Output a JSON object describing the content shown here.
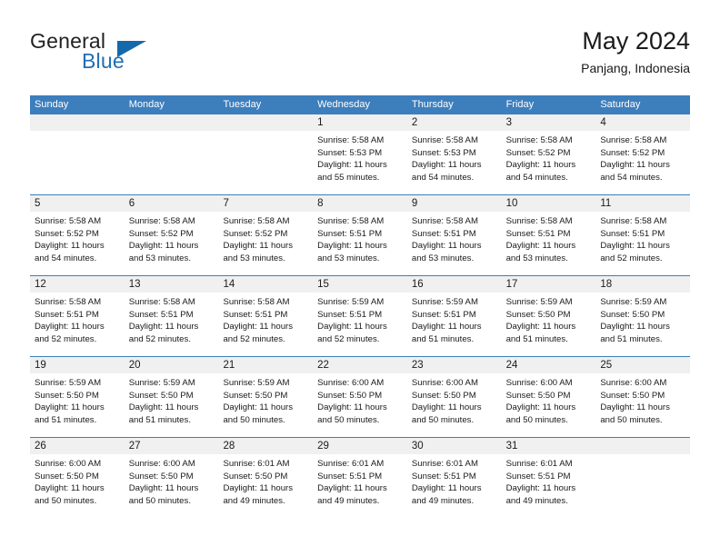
{
  "brand": {
    "word_one": "General",
    "word_two": "Blue",
    "triangle_icon": "triangle-icon",
    "colors": {
      "accent": "#1469ab",
      "text": "#222222"
    }
  },
  "header": {
    "title": "May 2024",
    "location": "Panjang, Indonesia"
  },
  "calendar": {
    "header_color": "#3d7ebd",
    "day_band_color": "#f0f0f0",
    "day_names": [
      "Sunday",
      "Monday",
      "Tuesday",
      "Wednesday",
      "Thursday",
      "Friday",
      "Saturday"
    ],
    "weeks": [
      [
        {
          "empty": true
        },
        {
          "empty": true
        },
        {
          "empty": true
        },
        {
          "day": "1",
          "sunrise": "Sunrise: 5:58 AM",
          "sunset": "Sunset: 5:53 PM",
          "daylight_1": "Daylight: 11 hours",
          "daylight_2": "and 55 minutes."
        },
        {
          "day": "2",
          "sunrise": "Sunrise: 5:58 AM",
          "sunset": "Sunset: 5:53 PM",
          "daylight_1": "Daylight: 11 hours",
          "daylight_2": "and 54 minutes."
        },
        {
          "day": "3",
          "sunrise": "Sunrise: 5:58 AM",
          "sunset": "Sunset: 5:52 PM",
          "daylight_1": "Daylight: 11 hours",
          "daylight_2": "and 54 minutes."
        },
        {
          "day": "4",
          "sunrise": "Sunrise: 5:58 AM",
          "sunset": "Sunset: 5:52 PM",
          "daylight_1": "Daylight: 11 hours",
          "daylight_2": "and 54 minutes."
        }
      ],
      [
        {
          "day": "5",
          "sunrise": "Sunrise: 5:58 AM",
          "sunset": "Sunset: 5:52 PM",
          "daylight_1": "Daylight: 11 hours",
          "daylight_2": "and 54 minutes."
        },
        {
          "day": "6",
          "sunrise": "Sunrise: 5:58 AM",
          "sunset": "Sunset: 5:52 PM",
          "daylight_1": "Daylight: 11 hours",
          "daylight_2": "and 53 minutes."
        },
        {
          "day": "7",
          "sunrise": "Sunrise: 5:58 AM",
          "sunset": "Sunset: 5:52 PM",
          "daylight_1": "Daylight: 11 hours",
          "daylight_2": "and 53 minutes."
        },
        {
          "day": "8",
          "sunrise": "Sunrise: 5:58 AM",
          "sunset": "Sunset: 5:51 PM",
          "daylight_1": "Daylight: 11 hours",
          "daylight_2": "and 53 minutes."
        },
        {
          "day": "9",
          "sunrise": "Sunrise: 5:58 AM",
          "sunset": "Sunset: 5:51 PM",
          "daylight_1": "Daylight: 11 hours",
          "daylight_2": "and 53 minutes."
        },
        {
          "day": "10",
          "sunrise": "Sunrise: 5:58 AM",
          "sunset": "Sunset: 5:51 PM",
          "daylight_1": "Daylight: 11 hours",
          "daylight_2": "and 53 minutes."
        },
        {
          "day": "11",
          "sunrise": "Sunrise: 5:58 AM",
          "sunset": "Sunset: 5:51 PM",
          "daylight_1": "Daylight: 11 hours",
          "daylight_2": "and 52 minutes."
        }
      ],
      [
        {
          "day": "12",
          "sunrise": "Sunrise: 5:58 AM",
          "sunset": "Sunset: 5:51 PM",
          "daylight_1": "Daylight: 11 hours",
          "daylight_2": "and 52 minutes."
        },
        {
          "day": "13",
          "sunrise": "Sunrise: 5:58 AM",
          "sunset": "Sunset: 5:51 PM",
          "daylight_1": "Daylight: 11 hours",
          "daylight_2": "and 52 minutes."
        },
        {
          "day": "14",
          "sunrise": "Sunrise: 5:58 AM",
          "sunset": "Sunset: 5:51 PM",
          "daylight_1": "Daylight: 11 hours",
          "daylight_2": "and 52 minutes."
        },
        {
          "day": "15",
          "sunrise": "Sunrise: 5:59 AM",
          "sunset": "Sunset: 5:51 PM",
          "daylight_1": "Daylight: 11 hours",
          "daylight_2": "and 52 minutes."
        },
        {
          "day": "16",
          "sunrise": "Sunrise: 5:59 AM",
          "sunset": "Sunset: 5:51 PM",
          "daylight_1": "Daylight: 11 hours",
          "daylight_2": "and 51 minutes."
        },
        {
          "day": "17",
          "sunrise": "Sunrise: 5:59 AM",
          "sunset": "Sunset: 5:50 PM",
          "daylight_1": "Daylight: 11 hours",
          "daylight_2": "and 51 minutes."
        },
        {
          "day": "18",
          "sunrise": "Sunrise: 5:59 AM",
          "sunset": "Sunset: 5:50 PM",
          "daylight_1": "Daylight: 11 hours",
          "daylight_2": "and 51 minutes."
        }
      ],
      [
        {
          "day": "19",
          "sunrise": "Sunrise: 5:59 AM",
          "sunset": "Sunset: 5:50 PM",
          "daylight_1": "Daylight: 11 hours",
          "daylight_2": "and 51 minutes."
        },
        {
          "day": "20",
          "sunrise": "Sunrise: 5:59 AM",
          "sunset": "Sunset: 5:50 PM",
          "daylight_1": "Daylight: 11 hours",
          "daylight_2": "and 51 minutes."
        },
        {
          "day": "21",
          "sunrise": "Sunrise: 5:59 AM",
          "sunset": "Sunset: 5:50 PM",
          "daylight_1": "Daylight: 11 hours",
          "daylight_2": "and 50 minutes."
        },
        {
          "day": "22",
          "sunrise": "Sunrise: 6:00 AM",
          "sunset": "Sunset: 5:50 PM",
          "daylight_1": "Daylight: 11 hours",
          "daylight_2": "and 50 minutes."
        },
        {
          "day": "23",
          "sunrise": "Sunrise: 6:00 AM",
          "sunset": "Sunset: 5:50 PM",
          "daylight_1": "Daylight: 11 hours",
          "daylight_2": "and 50 minutes."
        },
        {
          "day": "24",
          "sunrise": "Sunrise: 6:00 AM",
          "sunset": "Sunset: 5:50 PM",
          "daylight_1": "Daylight: 11 hours",
          "daylight_2": "and 50 minutes."
        },
        {
          "day": "25",
          "sunrise": "Sunrise: 6:00 AM",
          "sunset": "Sunset: 5:50 PM",
          "daylight_1": "Daylight: 11 hours",
          "daylight_2": "and 50 minutes."
        }
      ],
      [
        {
          "day": "26",
          "sunrise": "Sunrise: 6:00 AM",
          "sunset": "Sunset: 5:50 PM",
          "daylight_1": "Daylight: 11 hours",
          "daylight_2": "and 50 minutes."
        },
        {
          "day": "27",
          "sunrise": "Sunrise: 6:00 AM",
          "sunset": "Sunset: 5:50 PM",
          "daylight_1": "Daylight: 11 hours",
          "daylight_2": "and 50 minutes."
        },
        {
          "day": "28",
          "sunrise": "Sunrise: 6:01 AM",
          "sunset": "Sunset: 5:50 PM",
          "daylight_1": "Daylight: 11 hours",
          "daylight_2": "and 49 minutes."
        },
        {
          "day": "29",
          "sunrise": "Sunrise: 6:01 AM",
          "sunset": "Sunset: 5:51 PM",
          "daylight_1": "Daylight: 11 hours",
          "daylight_2": "and 49 minutes."
        },
        {
          "day": "30",
          "sunrise": "Sunrise: 6:01 AM",
          "sunset": "Sunset: 5:51 PM",
          "daylight_1": "Daylight: 11 hours",
          "daylight_2": "and 49 minutes."
        },
        {
          "day": "31",
          "sunrise": "Sunrise: 6:01 AM",
          "sunset": "Sunset: 5:51 PM",
          "daylight_1": "Daylight: 11 hours",
          "daylight_2": "and 49 minutes."
        },
        {
          "empty": true
        }
      ]
    ]
  }
}
